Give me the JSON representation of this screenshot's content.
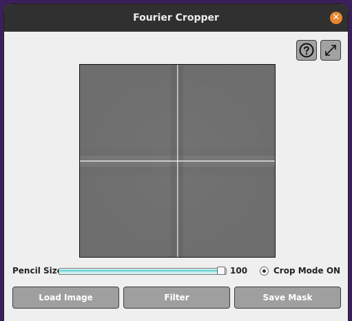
{
  "window": {
    "title": "Fourier Cropper",
    "close_icon": "close-icon"
  },
  "toolbar": {
    "help_icon": "help-icon",
    "expand_icon": "expand-icon"
  },
  "controls": {
    "pencil_label": "Pencil Size:",
    "pencil_value": "100",
    "pencil_fraction": 1.0,
    "crop_mode_label": "Crop Mode ON",
    "crop_mode_selected": true
  },
  "buttons": {
    "load": "Load Image",
    "filter": "Filter",
    "save": "Save Mask"
  },
  "colors": {
    "titlebar": "#303030",
    "close_button": "#e9862e",
    "slider_fill": "#5fd0d2",
    "button": "#9f9f9f"
  }
}
